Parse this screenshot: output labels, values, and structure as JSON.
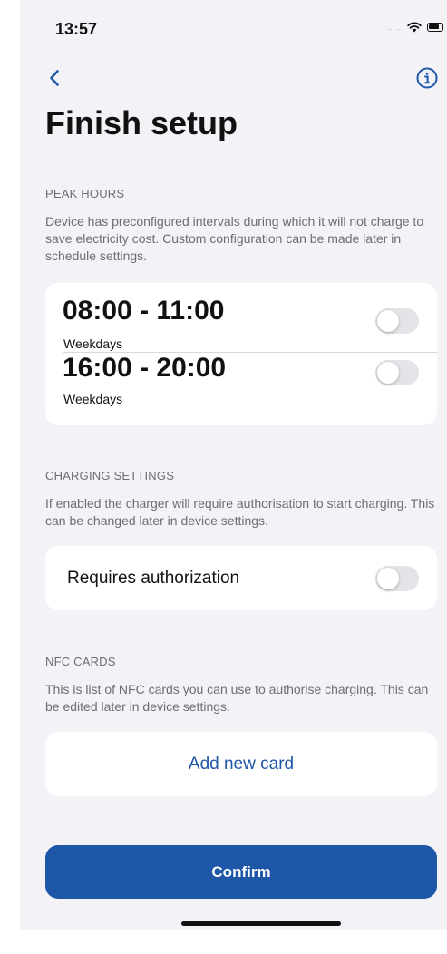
{
  "status_bar": {
    "time": "13:57",
    "signal": "....."
  },
  "nav": {
    "back_icon": "chevron-left-icon",
    "info_icon": "info-circle-icon"
  },
  "page": {
    "title": "Finish setup"
  },
  "peak_hours": {
    "header": "PEAK HOURS",
    "description": "Device has preconfigured intervals during which it will not charge to save electricity cost. Custom configuration can be made later in schedule settings.",
    "intervals": [
      {
        "time": "08:00 - 11:00",
        "days": "Weekdays",
        "enabled": false
      },
      {
        "time": "16:00 - 20:00",
        "days": "Weekdays",
        "enabled": false
      }
    ]
  },
  "charging_settings": {
    "header": "CHARGING SETTINGS",
    "description": "If enabled the charger will require authorisation to start charging. This can be changed later in device settings.",
    "requires_authorization_label": "Requires authorization",
    "requires_authorization_enabled": false
  },
  "nfc_cards": {
    "header": "NFC CARDS",
    "description": "This is list of NFC cards you can use to authorise charging. This can be edited later in device settings.",
    "add_label": "Add new card"
  },
  "confirm_label": "Confirm",
  "colors": {
    "accent": "#1e56a8",
    "background": "#f2f2f7",
    "card": "#ffffff",
    "secondary_text": "#6d6d72"
  }
}
